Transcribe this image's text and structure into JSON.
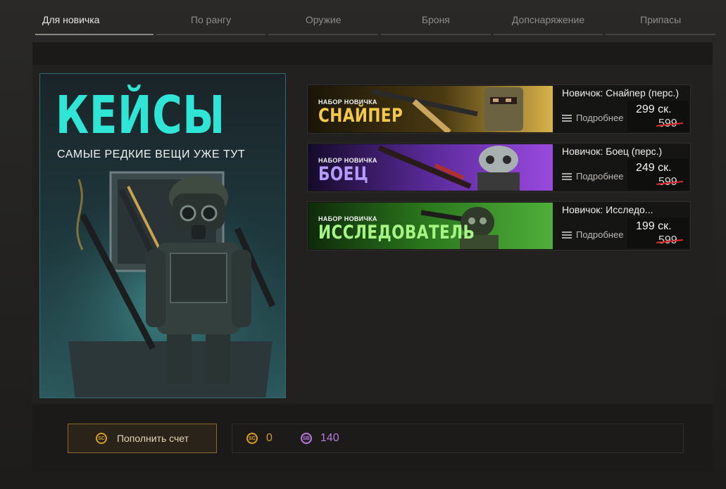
{
  "tabs": [
    {
      "label": "Для новичка",
      "active": true
    },
    {
      "label": "По рангу",
      "active": false
    },
    {
      "label": "Оружие",
      "active": false
    },
    {
      "label": "Броня",
      "active": false
    },
    {
      "label": "Допснаряжение",
      "active": false
    },
    {
      "label": "Припасы",
      "active": false
    }
  ],
  "promo": {
    "title": "КЕЙСЫ",
    "subtitle": "САМЫЕ РЕДКИЕ ВЕЩИ УЖЕ ТУТ"
  },
  "cards": [
    {
      "banner_small": "НАБОР НОВИЧКА",
      "banner_big": "СНАЙПЕР",
      "banner_color": "#f4c94a",
      "title": "Новичок: Снайпер (перс.)",
      "details": "Подробнее",
      "price": "299 ск.",
      "old_price": "599"
    },
    {
      "banner_small": "НАБОР НОВИЧКА",
      "banner_big": "БОЕЦ",
      "banner_color": "#a78cff",
      "title": "Новичок: Боец (перс.)",
      "details": "Подробнее",
      "price": "249 ск.",
      "old_price": "599"
    },
    {
      "banner_small": "НАБОР НОВИЧКА",
      "banner_big": "ИССЛЕДОВАТЕЛЬ",
      "banner_color": "#9cf07a",
      "title": "Новичок: Исследо...",
      "details": "Подробнее",
      "price": "199 ск.",
      "old_price": "599"
    }
  ],
  "footer": {
    "topup_label": "Пополнить счет",
    "coin_icon": "sc-coin-icon",
    "sc_amount": "0",
    "sb_icon": "sb-coin-icon",
    "sb_amount": "140"
  }
}
